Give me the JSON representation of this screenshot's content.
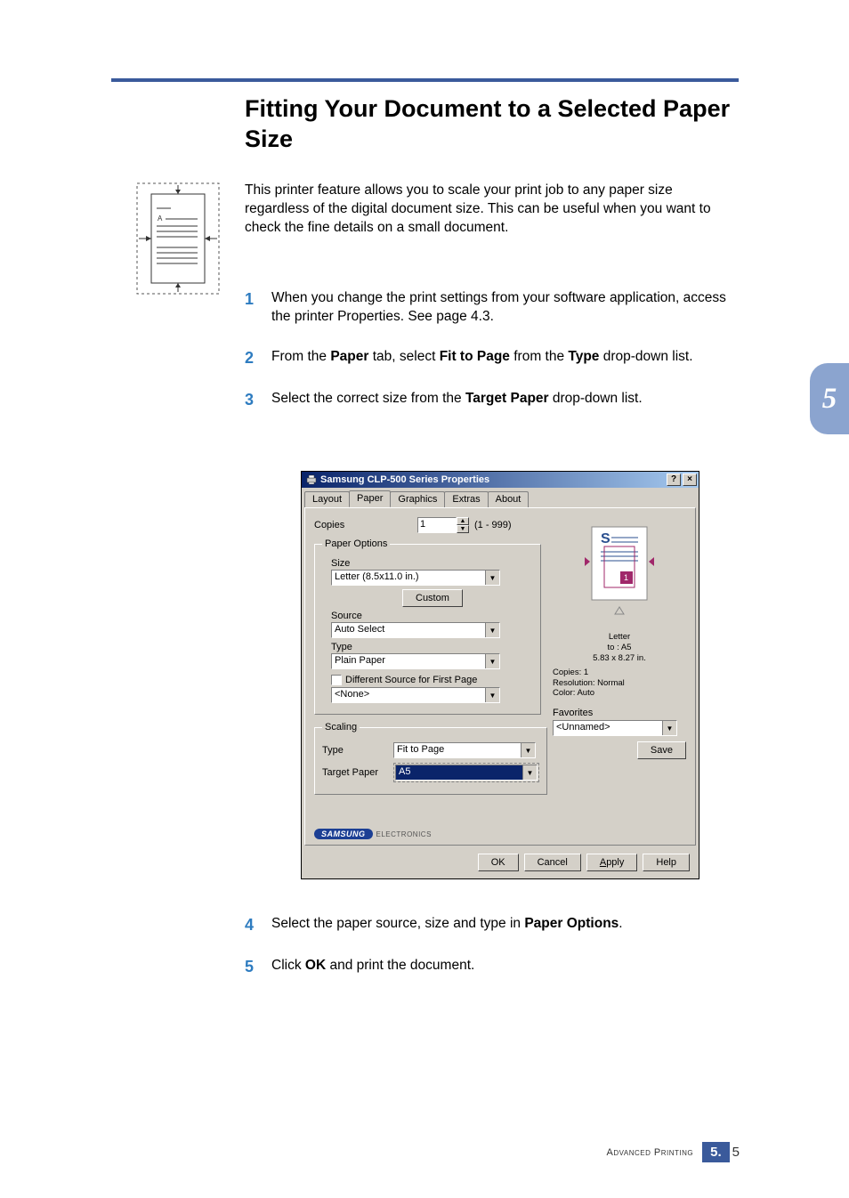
{
  "title": "Fitting Your Document to a Selected Paper Size",
  "intro": "This printer feature allows you to scale your print job to any paper size regardless of the digital document size. This can be useful when you want to check the fine details on a small document.",
  "steps": [
    {
      "num": "1",
      "t1": "When you change the print settings from your software application, access the printer Properties. See page 4.3."
    },
    {
      "num": "2",
      "t1": "From the ",
      "b1": "Paper",
      "t2": " tab, select ",
      "b2": "Fit to Page",
      "t3": " from the ",
      "b3": "Type",
      "t4": " drop-down list."
    },
    {
      "num": "3",
      "t1": "Select the correct size from the ",
      "b1": "Target Paper",
      "t2": " drop-down list."
    },
    {
      "num": "4",
      "t1": "Select the paper source, size and type in ",
      "b1": "Paper Options",
      "t2": "."
    },
    {
      "num": "5",
      "t1": "Click ",
      "b1": "OK",
      "t2": " and print the document."
    }
  ],
  "chapter_tab": "5",
  "dialog": {
    "title": "Samsung CLP-500 Series Properties",
    "tabs": [
      "Layout",
      "Paper",
      "Graphics",
      "Extras",
      "About"
    ],
    "active_tab": 1,
    "copies_label": "Copies",
    "copies_value": "1",
    "copies_range": "(1 - 999)",
    "group_paper": "Paper Options",
    "size_label": "Size",
    "size_value": "Letter (8.5x11.0 in.)",
    "custom_btn": "Custom",
    "source_label": "Source",
    "source_value": "Auto Select",
    "type_label": "Type",
    "type_value": "Plain Paper",
    "diff_source": "Different Source for First Page",
    "diff_value": "<None>",
    "group_scaling": "Scaling",
    "scaling_type_label": "Type",
    "scaling_type_value": "Fit to Page",
    "target_label": "Target Paper",
    "target_value": "A5",
    "preview": {
      "line1": "Letter",
      "line2": "to : A5",
      "line3": "5.83 x 8.27 in.",
      "line4": "Copies: 1",
      "line5": "Resolution: Normal",
      "line6": "Color: Auto"
    },
    "favorites_label": "Favorites",
    "favorites_value": "<Unnamed>",
    "save_btn": "Save",
    "logo_brand": "SAMSUNG",
    "logo_sub": "ELECTRONICS",
    "buttons": {
      "ok": "OK",
      "cancel": "Cancel",
      "apply": "Apply",
      "help": "Help"
    }
  },
  "footer": {
    "label": "Advanced Printing",
    "chapter": "5.",
    "page": "5"
  }
}
